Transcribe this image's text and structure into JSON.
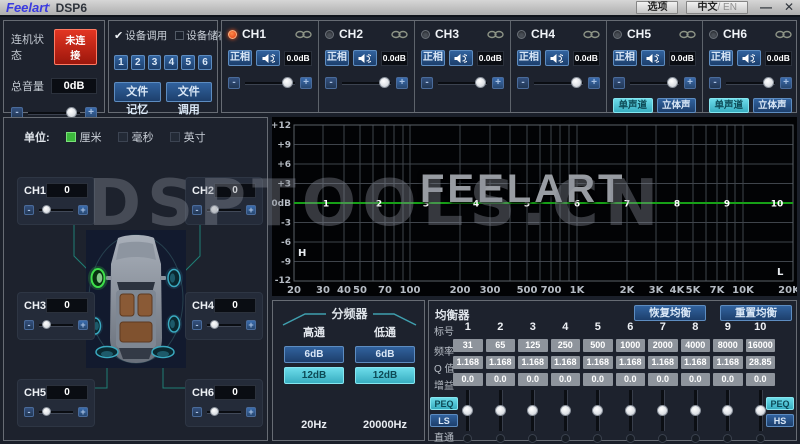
{
  "titlebar": {
    "brand": "Feelart",
    "brand_mark": "’",
    "product": "DSP6",
    "options": "选项",
    "lang_zh": "中文",
    "lang_en": "/ EN",
    "minimize": "—",
    "close": "✕"
  },
  "ui": {
    "minus": "-",
    "plus": "+"
  },
  "connection": {
    "status_label": "连机状态",
    "status_value": "未连接",
    "volume_label": "总音量",
    "volume_value": "0dB"
  },
  "device": {
    "check": "✔",
    "recall": "设备调用",
    "store": "设备储存",
    "presets": [
      "1",
      "2",
      "3",
      "4",
      "5",
      "6"
    ],
    "file_save": "文件记忆",
    "file_load": "文件调用"
  },
  "channels": [
    {
      "label": "CH1",
      "phase": "正相",
      "gain": "0.0dB"
    },
    {
      "label": "CH2",
      "phase": "正相",
      "gain": "0.0dB"
    },
    {
      "label": "CH3",
      "phase": "正相",
      "gain": "0.0dB"
    },
    {
      "label": "CH4",
      "phase": "正相",
      "gain": "0.0dB"
    },
    {
      "label": "CH5",
      "phase": "正相",
      "gain": "0.0dB",
      "mono": "单声道",
      "stereo": "立体声"
    },
    {
      "label": "CH6",
      "phase": "正相",
      "gain": "0.0dB",
      "mono": "单声道",
      "stereo": "立体声"
    }
  ],
  "delay": {
    "unit_label": "单位:",
    "units": [
      "厘米",
      "毫秒",
      "英寸"
    ],
    "channels": [
      {
        "label": "CH1",
        "value": "0"
      },
      {
        "label": "CH2",
        "value": "0"
      },
      {
        "label": "CH3",
        "value": "0"
      },
      {
        "label": "CH4",
        "value": "0"
      },
      {
        "label": "CH5",
        "value": "0"
      },
      {
        "label": "CH6",
        "value": "0"
      }
    ]
  },
  "graph": {
    "y_labels": [
      "+12",
      "+9",
      "+6",
      "+3",
      "0dB",
      "-3",
      "-6",
      "-9",
      "-12"
    ],
    "x_labels": [
      "20",
      "30",
      "40",
      "50",
      "70",
      "100",
      "200",
      "300",
      "500",
      "700",
      "1K",
      "2K",
      "3K",
      "4K",
      "5K",
      "7K",
      "10K",
      "20K"
    ],
    "bands": [
      "1",
      "2",
      "3",
      "4",
      "5",
      "6",
      "7",
      "8",
      "9",
      "10"
    ],
    "hp_marker": "H",
    "lp_marker": "L",
    "brand_watermark": "FEELART",
    "site_watermark": "DSPTOOLS.CN",
    "curve_color": "#17a017"
  },
  "crossover": {
    "title": "分频器",
    "hp_label": "高通",
    "lp_label": "低通",
    "hp_slope_6": "6dB",
    "hp_slope_12": "12dB",
    "lp_slope_6": "6dB",
    "lp_slope_12": "12dB",
    "hp_freq": "20Hz",
    "lp_freq": "20000Hz"
  },
  "eq": {
    "title": "均衡器",
    "restore": "恢复均衡",
    "reset": "重置均衡",
    "rows": {
      "index": "标号",
      "freq": "频率",
      "q": "Q 值",
      "gain": "增益"
    },
    "bypass": "直通",
    "peq_left": "PEQ",
    "ls": "LS",
    "peq_right": "PEQ",
    "hs": "HS",
    "bands": [
      {
        "n": "1",
        "freq": "31",
        "q": "1.168",
        "gain": "0.0"
      },
      {
        "n": "2",
        "freq": "65",
        "q": "1.168",
        "gain": "0.0"
      },
      {
        "n": "3",
        "freq": "125",
        "q": "1.168",
        "gain": "0.0"
      },
      {
        "n": "4",
        "freq": "250",
        "q": "1.168",
        "gain": "0.0"
      },
      {
        "n": "5",
        "freq": "500",
        "q": "1.168",
        "gain": "0.0"
      },
      {
        "n": "6",
        "freq": "1000",
        "q": "1.168",
        "gain": "0.0"
      },
      {
        "n": "7",
        "freq": "2000",
        "q": "1.168",
        "gain": "0.0"
      },
      {
        "n": "8",
        "freq": "4000",
        "q": "1.168",
        "gain": "0.0"
      },
      {
        "n": "9",
        "freq": "8000",
        "q": "1.168",
        "gain": "0.0"
      },
      {
        "n": "10",
        "freq": "16000",
        "q": "28.85",
        "gain": "0.0"
      }
    ]
  }
}
